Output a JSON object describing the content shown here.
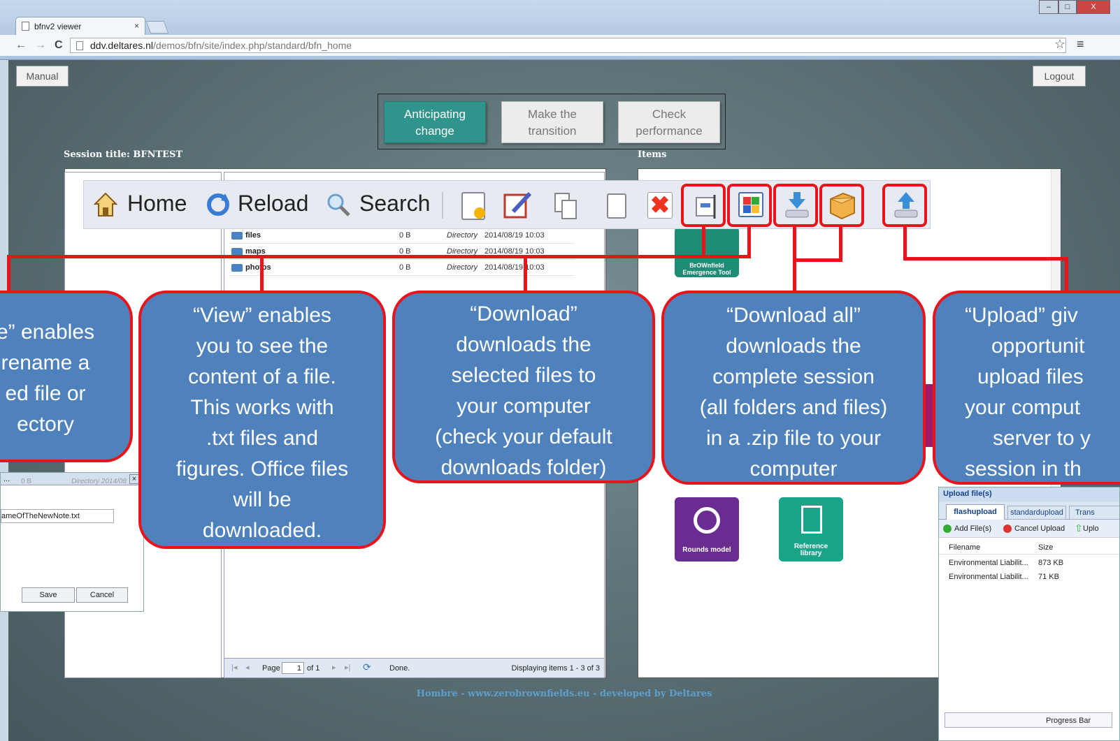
{
  "browser": {
    "tab_title": "bfnv2 viewer",
    "tab_close": "×",
    "url_host": "ddv.deltares.nl",
    "url_path": "/demos/bfn/site/index.php/standard/bfn_home",
    "star_icon": "☆",
    "menu_icon": "≡",
    "win_min": "–",
    "win_max": "□",
    "win_close": "X"
  },
  "header": {
    "manual": "Manual",
    "logout": "Logout"
  },
  "nav": {
    "anticipating": [
      "Anticipating",
      "change"
    ],
    "transition": [
      "Make the",
      "transition"
    ],
    "performance": [
      "Check",
      "performance"
    ]
  },
  "session_title": "Session title: BFNTEST",
  "items_label": "Items",
  "toolbar": {
    "home": "Home",
    "reload": "Reload",
    "search": "Search"
  },
  "files": [
    {
      "name": "files",
      "size": "0 B",
      "type": "Directory",
      "date": "2014/08/19 10:03"
    },
    {
      "name": "maps",
      "size": "0 B",
      "type": "Directory",
      "date": "2014/08/19 10:03"
    },
    {
      "name": "photos",
      "size": "0 B",
      "type": "Directory",
      "date": "2014/08/19 10:03"
    }
  ],
  "pager": {
    "page": "Page",
    "page_num": "1",
    "of": "of 1",
    "status": "Done.",
    "display": "Displaying items 1 - 3 of 3"
  },
  "callouts": {
    "rename": [
      "e” enables",
      "rename a",
      "ed file or",
      "ectory"
    ],
    "view": [
      "“View” enables",
      "you to see the",
      "content of a file.",
      "This works with",
      ".txt files and",
      "figures. Office files",
      "will be",
      "downloaded."
    ],
    "download": [
      "“Download”",
      "downloads the",
      "selected files to",
      "your computer",
      "(check your default",
      "downloads folder)"
    ],
    "download_all": [
      "“Download all”",
      "downloads the",
      "complete session",
      "(all folders and files)",
      "in a .zip file to your",
      "computer"
    ],
    "upload": [
      "“Upload” giv",
      "opportunit",
      "upload files",
      "your comput",
      "server to y",
      "session in th"
    ]
  },
  "apps": {
    "brownfield": [
      "BrOWnfield",
      "Emergence Tool"
    ],
    "rounds": "Rounds model",
    "reference": [
      "Reference",
      "library"
    ]
  },
  "note_dialog": {
    "title": "...",
    "close": "×",
    "filename": "ameOfTheNewNote.txt",
    "save": "Save",
    "cancel": "Cancel",
    "bg_size": "0 B",
    "bg_type": "Directory 2014/08"
  },
  "upload_dialog": {
    "title": "Upload file(s)",
    "tabs": [
      "flashupload",
      "standardupload",
      "Trans"
    ],
    "add": "Add File(s)",
    "cancel": "Cancel Upload",
    "upload": "Uplo",
    "col_file": "Filename",
    "col_size": "Size",
    "rows": [
      {
        "file": "Environmental Liabilit...",
        "size": "873 KB"
      },
      {
        "file": "Environmental Liabilit...",
        "size": "71 KB"
      }
    ],
    "progress": "Progress Bar"
  },
  "footer": "Hombre - www.zerobrownfields.eu - developed by Deltares",
  "colors": {
    "accent": "#2f948b",
    "callout": "#4f81bd",
    "highlight": "#e8141b"
  }
}
